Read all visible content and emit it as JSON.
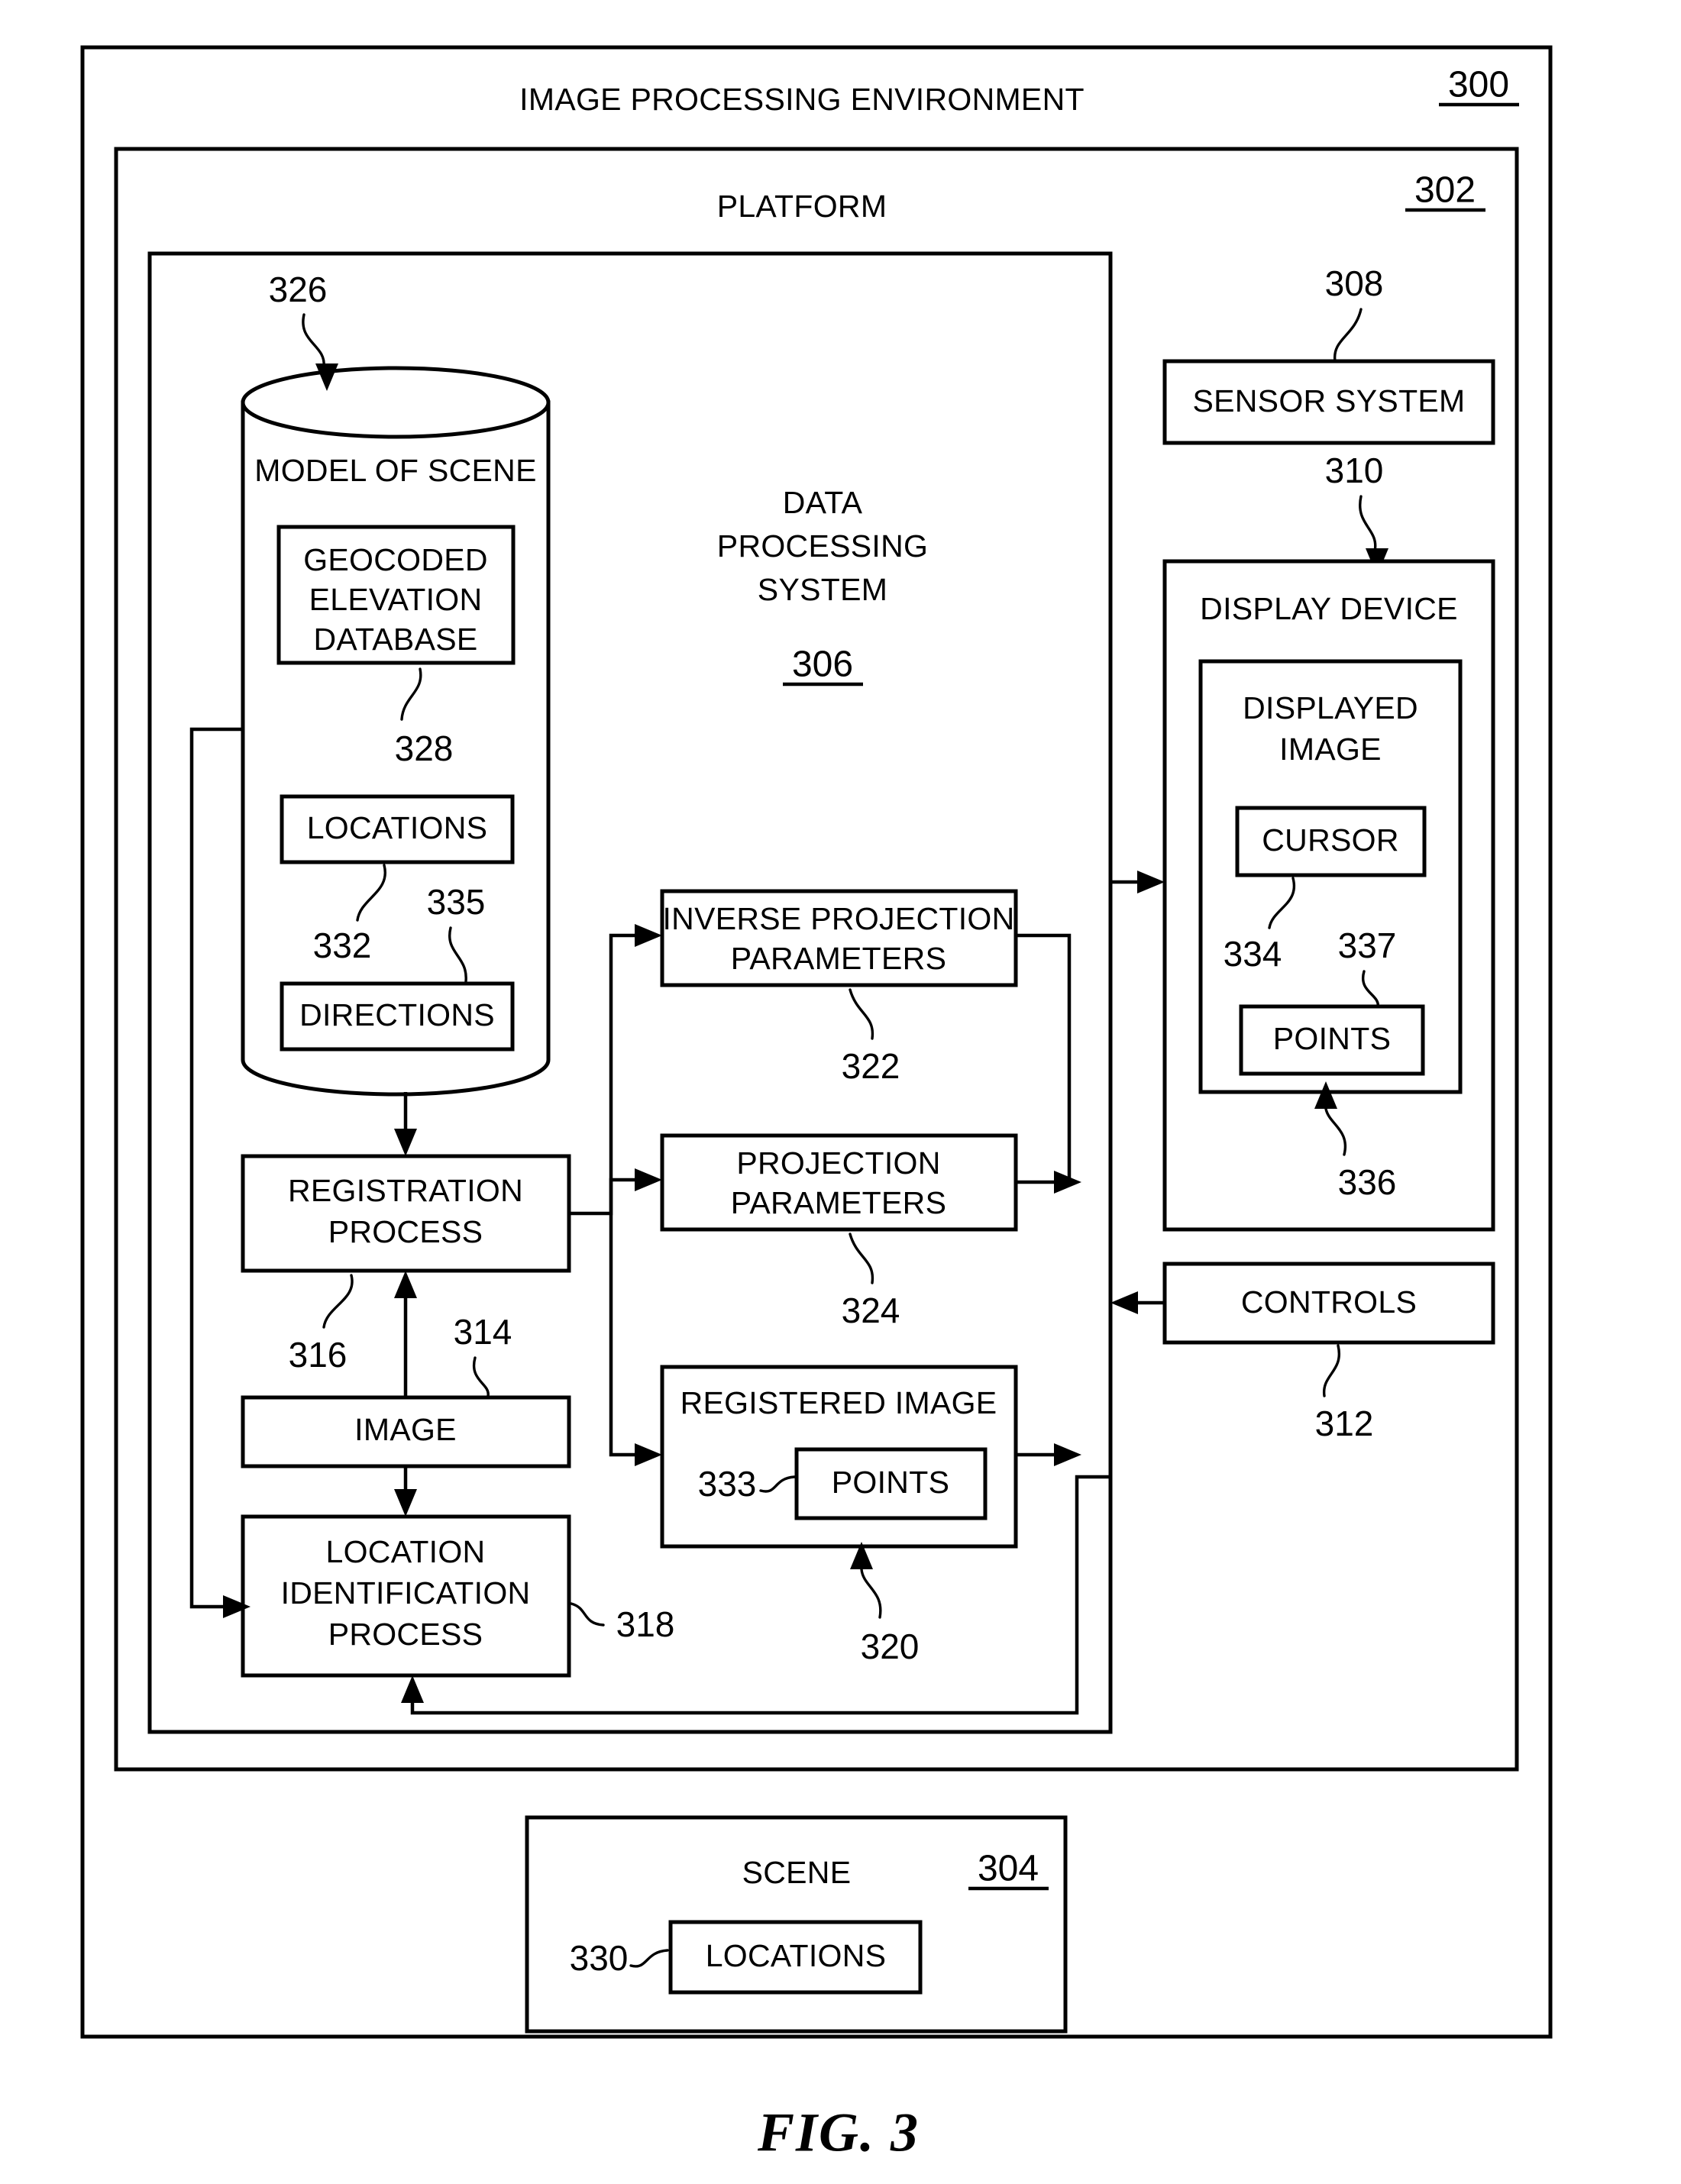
{
  "figure": {
    "caption": "FIG. 3",
    "outer_title": "IMAGE PROCESSING ENVIRONMENT",
    "outer_ref": "300",
    "platform_title": "PLATFORM",
    "platform_ref": "302"
  },
  "data_processing_system": {
    "title_line1": "DATA",
    "title_line2": "PROCESSING",
    "title_line3": "SYSTEM",
    "ref": "306"
  },
  "model_of_scene": {
    "title": "MODEL OF SCENE",
    "ref": "326",
    "geocoded_db": {
      "line1": "GEOCODED",
      "line2": "ELEVATION",
      "line3": "DATABASE",
      "ref": "328"
    },
    "locations": {
      "label": "LOCATIONS",
      "ref": "332"
    },
    "directions": {
      "label": "DIRECTIONS",
      "ref": "335"
    }
  },
  "processes": {
    "registration": {
      "line1": "REGISTRATION",
      "line2": "PROCESS",
      "ref": "316"
    },
    "image": {
      "label": "IMAGE",
      "ref": "314"
    },
    "location_identification": {
      "line1": "LOCATION",
      "line2": "IDENTIFICATION",
      "line3": "PROCESS",
      "ref": "318"
    }
  },
  "parameters": {
    "inverse_projection": {
      "line1": "INVERSE PROJECTION",
      "line2": "PARAMETERS",
      "ref": "322"
    },
    "projection": {
      "line1": "PROJECTION",
      "line2": "PARAMETERS",
      "ref": "324"
    },
    "registered_image": {
      "label": "REGISTERED IMAGE",
      "ref": "320",
      "points": {
        "label": "POINTS",
        "ref": "333"
      }
    }
  },
  "sensor_system": {
    "label": "SENSOR SYSTEM",
    "ref": "308"
  },
  "display_device": {
    "label": "DISPLAY DEVICE",
    "ref": "310",
    "displayed_image": {
      "line1": "DISPLAYED",
      "line2": "IMAGE",
      "ref": "336"
    },
    "cursor": {
      "label": "CURSOR",
      "ref": "334"
    },
    "points": {
      "label": "POINTS",
      "ref": "337"
    }
  },
  "controls": {
    "label": "CONTROLS",
    "ref": "312"
  },
  "scene": {
    "label": "SCENE",
    "ref": "304",
    "locations": {
      "label": "LOCATIONS",
      "ref": "330"
    }
  }
}
